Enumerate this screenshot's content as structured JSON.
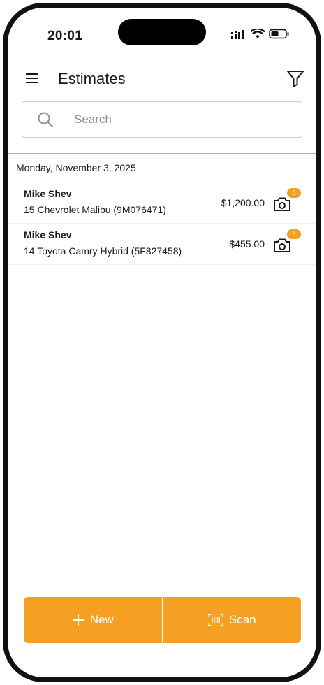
{
  "status_bar": {
    "time": "20:01"
  },
  "header": {
    "title": "Estimates"
  },
  "search": {
    "placeholder": "Search",
    "value": ""
  },
  "date_group": {
    "label": "Monday, November 3, 2025"
  },
  "estimates": [
    {
      "customer": "Mike Shev",
      "vehicle": "15 Chevrolet Malibu (9M076471)",
      "amount": "$1,200.00",
      "photo_count": "0"
    },
    {
      "customer": "Mike Shev",
      "vehicle": "14 Toyota Camry Hybrid (5F827458)",
      "amount": "$455.00",
      "photo_count": "3"
    }
  ],
  "actions": {
    "new_label": "New",
    "scan_label": "Scan"
  },
  "colors": {
    "accent": "#f5a023",
    "divider": "#f0a54a"
  },
  "icons": [
    "menu-icon",
    "filter-icon",
    "search-icon",
    "camera-icon",
    "plus-icon",
    "barcode-scan-icon",
    "signal-icon",
    "wifi-icon",
    "battery-icon"
  ]
}
